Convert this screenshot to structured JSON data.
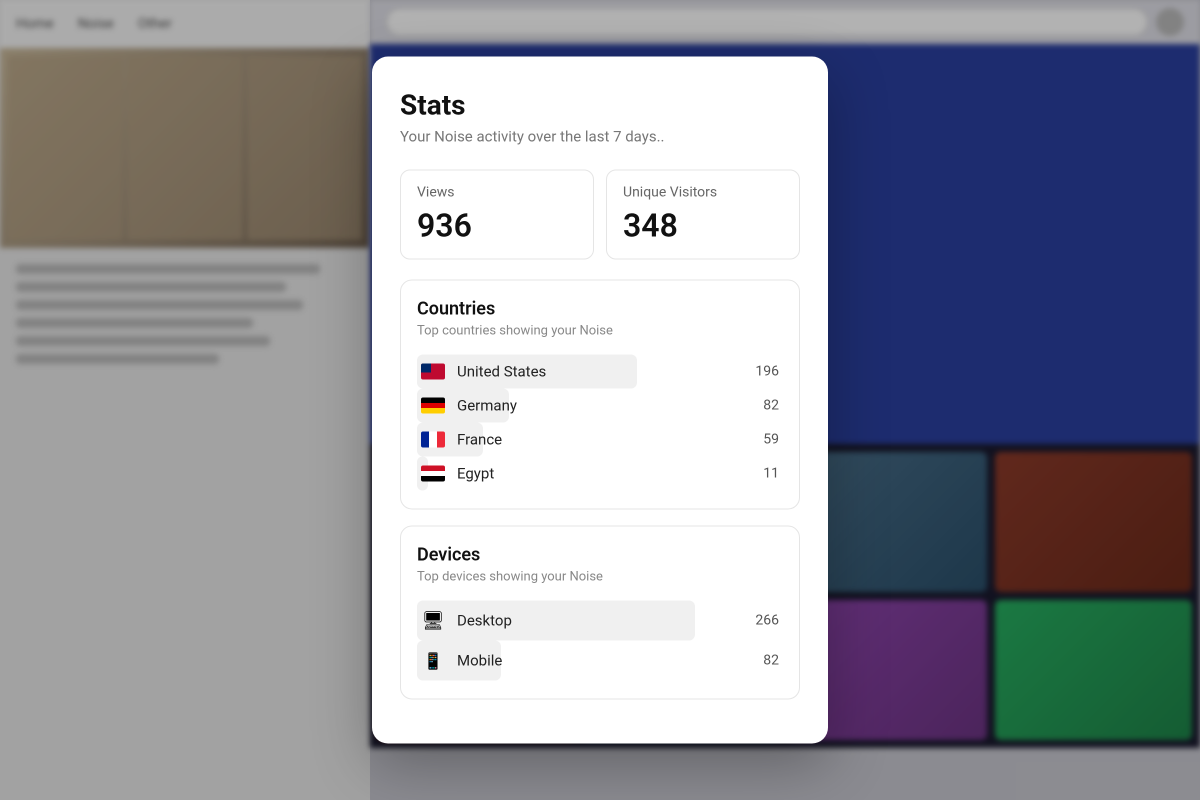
{
  "modal": {
    "title": "Stats",
    "subtitle": "Your Noise activity over the last 7 days..",
    "views_label": "Views",
    "views_value": "936",
    "visitors_label": "Unique Visitors",
    "visitors_value": "348",
    "countries_title": "Countries",
    "countries_subtitle": "Top countries showing your Noise",
    "devices_title": "Devices",
    "devices_subtitle": "Top devices showing your Noise",
    "countries": [
      {
        "name": "United States",
        "count": "196",
        "flag": "us",
        "bar": 60
      },
      {
        "name": "Germany",
        "count": "82",
        "flag": "de",
        "bar": 25
      },
      {
        "name": "France",
        "count": "59",
        "flag": "fr",
        "bar": 18
      },
      {
        "name": "Egypt",
        "count": "11",
        "flag": "eg",
        "bar": 3
      }
    ],
    "devices": [
      {
        "name": "Desktop",
        "count": "266",
        "icon": "desktop",
        "bar": 76
      },
      {
        "name": "Mobile",
        "count": "82",
        "icon": "mobile",
        "bar": 23
      }
    ]
  },
  "nav": {
    "items": [
      "Home",
      "Noise",
      "Other"
    ]
  }
}
